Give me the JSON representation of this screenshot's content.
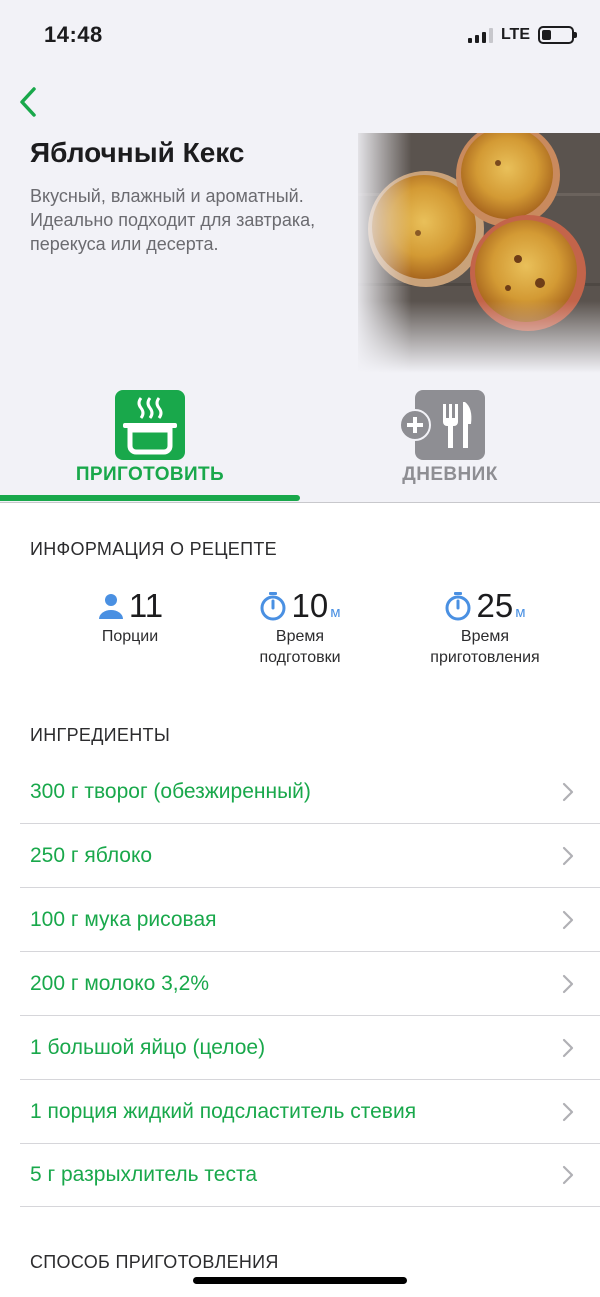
{
  "status_bar": {
    "time": "14:48",
    "network": "LTE"
  },
  "recipe": {
    "title": "Яблочный Кекс",
    "description": "Вкусный, влажный и ароматный. Идеально подходит для завтрака, перекуса или десерта."
  },
  "tabs": [
    {
      "label": "ПРИГОТОВИТЬ",
      "icon": "cooking-pot-icon",
      "active": true
    },
    {
      "label": "ДНЕВНИК",
      "icon": "add-to-diary-cutlery-icon",
      "active": false
    }
  ],
  "info": {
    "header": "ИНФОРМАЦИЯ О РЕЦЕПТЕ",
    "servings": {
      "value": "11",
      "label": "Порции",
      "icon": "person-icon"
    },
    "prep": {
      "value": "10",
      "unit": "м",
      "label_1": "Время",
      "label_2": "подготовки",
      "icon": "stopwatch-icon"
    },
    "cook": {
      "value": "25",
      "unit": "м",
      "label_1": "Время",
      "label_2": "приготовления",
      "icon": "stopwatch-icon"
    }
  },
  "ingredients": {
    "header": "ИНГРЕДИЕНТЫ",
    "items": [
      "300 г творог (обезжиренный)",
      "250 г яблоко",
      "100 г мука рисовая",
      "200 г молоко 3,2%",
      "1 большой яйцо (целое)",
      "1 порция жидкий подсластитель стевия",
      "5 г разрыхлитель теста"
    ]
  },
  "method": {
    "header": "СПОСОБ ПРИГОТОВЛЕНИЯ"
  },
  "colors": {
    "accent": "#19a84b",
    "inactive": "#8e8e93",
    "unit": "#4a90e2",
    "background": "#f2f2f7"
  }
}
